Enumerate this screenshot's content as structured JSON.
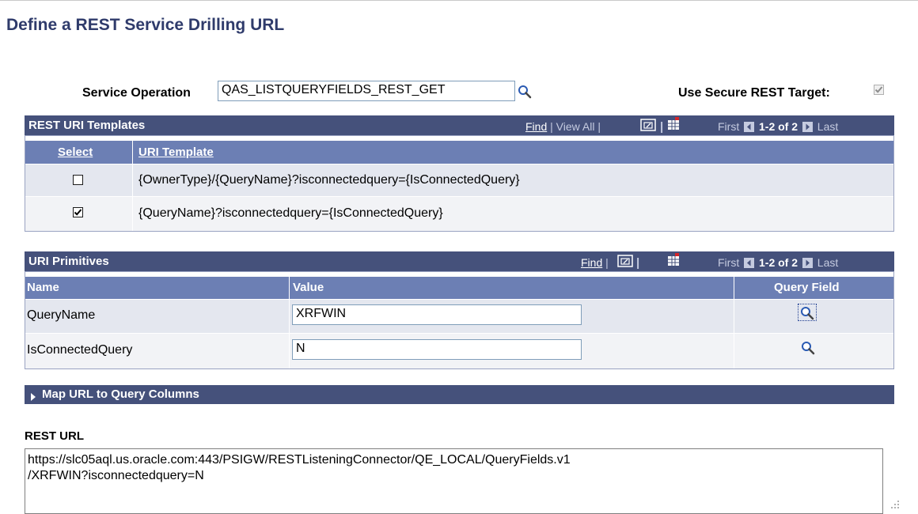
{
  "page": {
    "title": "Define a REST Service Drilling URL"
  },
  "service_operation": {
    "label": "Service Operation",
    "value": "QAS_LISTQUERYFIELDS_REST_GET",
    "lookup_icon": "magnifier-icon"
  },
  "secure_target": {
    "label": "Use Secure REST Target:",
    "checked": true,
    "disabled": true
  },
  "uri_templates": {
    "title": "REST URI Templates",
    "nav": {
      "find": "Find",
      "view_all": "View All",
      "first": "First",
      "range": "1-2 of 2",
      "last": "Last"
    },
    "columns": [
      "Select",
      "URI Template"
    ],
    "rows": [
      {
        "selected": false,
        "template": "{OwnerType}/{QueryName}?isconnectedquery={IsConnectedQuery}"
      },
      {
        "selected": true,
        "template": "{QueryName}?isconnectedquery={IsConnectedQuery}"
      }
    ]
  },
  "uri_primitives": {
    "title": "URI Primitives",
    "nav": {
      "find": "Find",
      "first": "First",
      "range": "1-2 of 2",
      "last": "Last"
    },
    "columns": [
      "Name",
      "Value",
      "Query Field"
    ],
    "rows": [
      {
        "name": "QueryName",
        "value": "XRFWIN"
      },
      {
        "name": "IsConnectedQuery",
        "value": "N"
      }
    ]
  },
  "map_section": {
    "label": "Map URL to Query Columns",
    "expanded": false
  },
  "rest_url": {
    "label": "REST URL",
    "line1": "https://slc05aql.us.oracle.com:443/PSIGW/RESTListeningConnector/QE_LOCAL/QueryFields.v1",
    "line2": "/XRFWIN?isconnectedquery=N"
  },
  "colors": {
    "title": "#2f3b6b",
    "grid_header": "#45517b",
    "column_header": "#6c7fb4",
    "row_alt_1": "#e4e7ef",
    "row_alt_2": "#f2f3f6"
  }
}
